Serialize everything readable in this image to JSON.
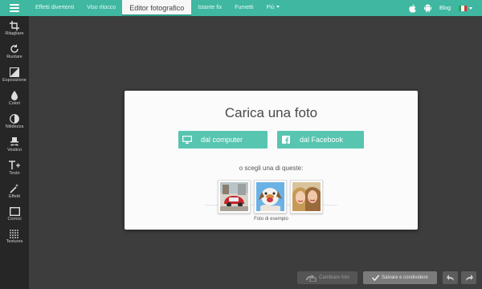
{
  "colors": {
    "accent": "#3fb7a1",
    "button": "#57c5b0",
    "sidebar": "#262626",
    "canvas": "#3d3d3d"
  },
  "topbar": {
    "menu_icon": "hamburger-icon",
    "nav": [
      {
        "label": "Effetti divertenti"
      },
      {
        "label": "Viso ritocco"
      },
      {
        "label": "Editor fotografico",
        "active": true
      },
      {
        "label": "Istante fix"
      },
      {
        "label": "Fumetti"
      },
      {
        "label": "Più"
      }
    ],
    "apple_icon": "apple-icon",
    "android_icon": "android-icon",
    "blog": "Blog",
    "language_icon": "italy-flag-icon"
  },
  "sidebar": {
    "tools": [
      {
        "label": "Ritagliare",
        "icon": "crop-icon"
      },
      {
        "label": "Ruotare",
        "icon": "rotate-icon"
      },
      {
        "label": "Esposizione",
        "icon": "exposure-icon"
      },
      {
        "label": "Colori",
        "icon": "color-drop-icon"
      },
      {
        "label": "Nitidezza",
        "icon": "sharpness-icon"
      },
      {
        "label": "Vestirsi",
        "icon": "hat-mustache-icon"
      },
      {
        "label": "Testo",
        "icon": "text-icon"
      },
      {
        "label": "Effetti",
        "icon": "magic-wand-icon"
      },
      {
        "label": "Cornici",
        "icon": "frame-icon"
      },
      {
        "label": "Textures",
        "icon": "texture-icon"
      }
    ]
  },
  "dialog": {
    "title": "Carica una foto",
    "from_computer": "dal computer",
    "from_facebook": "dal Facebook",
    "choose_text": "o scegli una di queste:",
    "sample_label": "Foto di esempio",
    "samples": [
      "sample-car-photo",
      "sample-dog-photo",
      "sample-girls-photo"
    ]
  },
  "bottom": {
    "change_photo": "Cambiare foto",
    "save_share": "Salvare e condividere",
    "undo_icon": "undo-icon",
    "redo_icon": "redo-icon"
  }
}
